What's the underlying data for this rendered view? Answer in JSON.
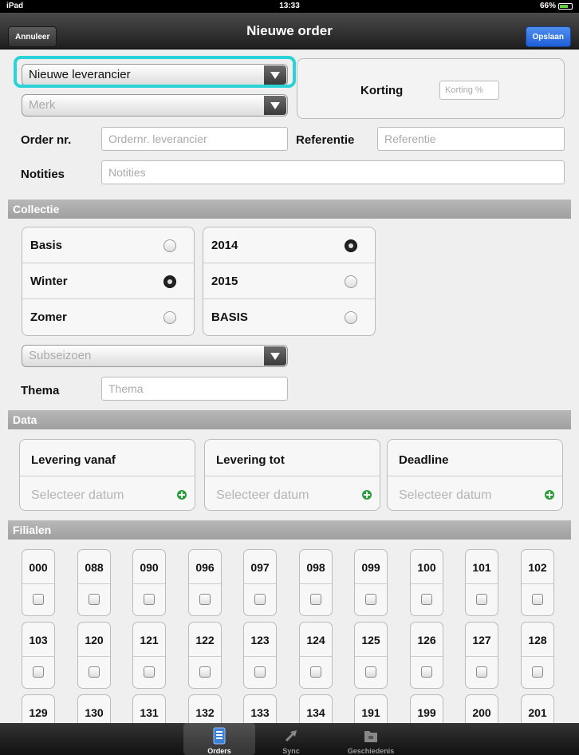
{
  "status_bar": {
    "device": "iPad",
    "time": "13:33",
    "battery": "66%"
  },
  "nav": {
    "title": "Nieuwe order",
    "cancel_label": "Annuleer",
    "save_label": "Opslaan"
  },
  "form": {
    "supplier_value": "Nieuwe leverancier",
    "brand_placeholder": "Merk",
    "discount_label": "Korting",
    "discount_placeholder": "Korting %",
    "order_label": "Order nr.",
    "order_placeholder": "Ordernr. leverancier",
    "reference_label": "Referentie",
    "reference_placeholder": "Referentie",
    "notes_label": "Notities",
    "notes_placeholder": "Notities"
  },
  "collectie": {
    "section_title": "Collectie",
    "left": [
      {
        "label": "Basis",
        "selected": false
      },
      {
        "label": "Winter",
        "selected": true
      },
      {
        "label": "Zomer",
        "selected": false
      }
    ],
    "right": [
      {
        "label": "2014",
        "selected": true
      },
      {
        "label": "2015",
        "selected": false
      },
      {
        "label": "BASIS",
        "selected": false
      }
    ],
    "subseason_placeholder": "Subseizoen",
    "theme_label": "Thema",
    "theme_placeholder": "Thema"
  },
  "data": {
    "section_title": "Data",
    "fields": [
      {
        "label": "Levering vanaf",
        "value": "Selecteer datum"
      },
      {
        "label": "Levering tot",
        "value": "Selecteer datum"
      },
      {
        "label": "Deadline",
        "value": "Selecteer datum"
      }
    ]
  },
  "filialen": {
    "section_title": "Filialen",
    "codes": [
      "000",
      "088",
      "090",
      "096",
      "097",
      "098",
      "099",
      "100",
      "101",
      "102",
      "103",
      "120",
      "121",
      "122",
      "123",
      "124",
      "125",
      "126",
      "127",
      "128",
      "129",
      "130",
      "131",
      "132",
      "133",
      "134",
      "191",
      "199",
      "200",
      "201"
    ]
  },
  "tabbar": {
    "tabs": [
      {
        "label": "Orders",
        "icon": "orders-icon",
        "active": true
      },
      {
        "label": "Sync",
        "icon": "sync-icon",
        "active": false
      },
      {
        "label": "Geschiedenis",
        "icon": "folder-icon",
        "active": false
      }
    ]
  }
}
